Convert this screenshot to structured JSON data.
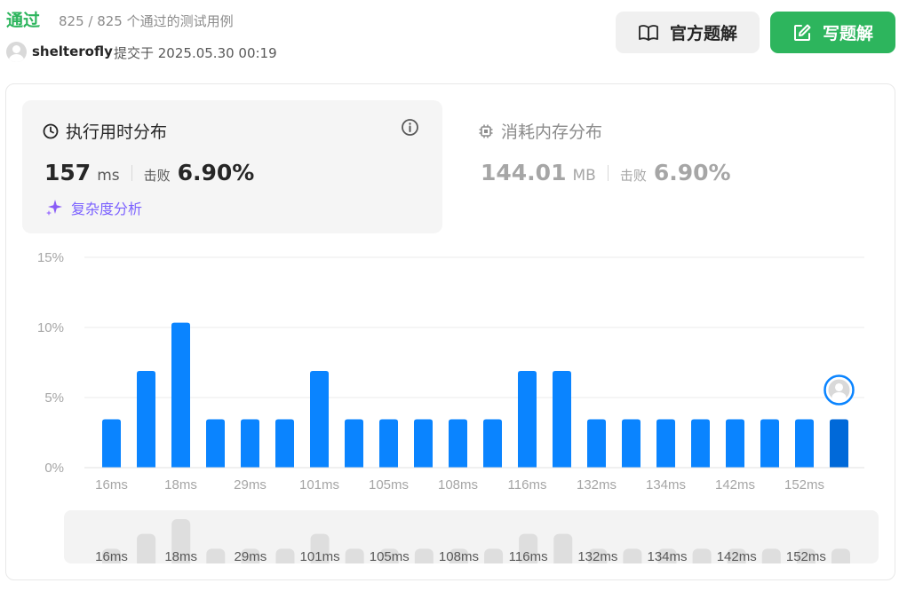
{
  "header": {
    "status": "通过",
    "passed": "825 / 825 个通过的测试用例",
    "username": "shelterofly",
    "submitted": "提交于 2025.05.30 00:19",
    "official_solution": "官方题解",
    "write_solution": "写题解"
  },
  "runtime": {
    "title": "执行用时分布",
    "value": "157",
    "unit": "ms",
    "beat_label": "击败",
    "beat_value": "6.90%",
    "complexity": "复杂度分析"
  },
  "memory": {
    "title": "消耗内存分布",
    "value": "144.01",
    "unit": "MB",
    "beat_label": "击败",
    "beat_value": "6.90%"
  },
  "colors": {
    "pass": "#2db55d",
    "bar": "#0a84ff",
    "bar_current": "#0069d9",
    "avatar_ring": "#0a84ff"
  },
  "chart_data": {
    "type": "bar",
    "yticks": [
      "0%",
      "5%",
      "10%",
      "15%"
    ],
    "ylim": [
      0,
      15
    ],
    "xtick_labels": [
      "16ms",
      "18ms",
      "29ms",
      "101ms",
      "105ms",
      "108ms",
      "116ms",
      "132ms",
      "134ms",
      "142ms",
      "152ms"
    ],
    "values": [
      3.45,
      6.9,
      10.34,
      3.45,
      3.45,
      3.45,
      6.9,
      3.45,
      3.45,
      3.45,
      3.45,
      3.45,
      6.9,
      6.9,
      3.45,
      3.45,
      3.45,
      3.45,
      3.45,
      3.45,
      3.45,
      3.45
    ],
    "current_index": 21,
    "grid": true
  }
}
